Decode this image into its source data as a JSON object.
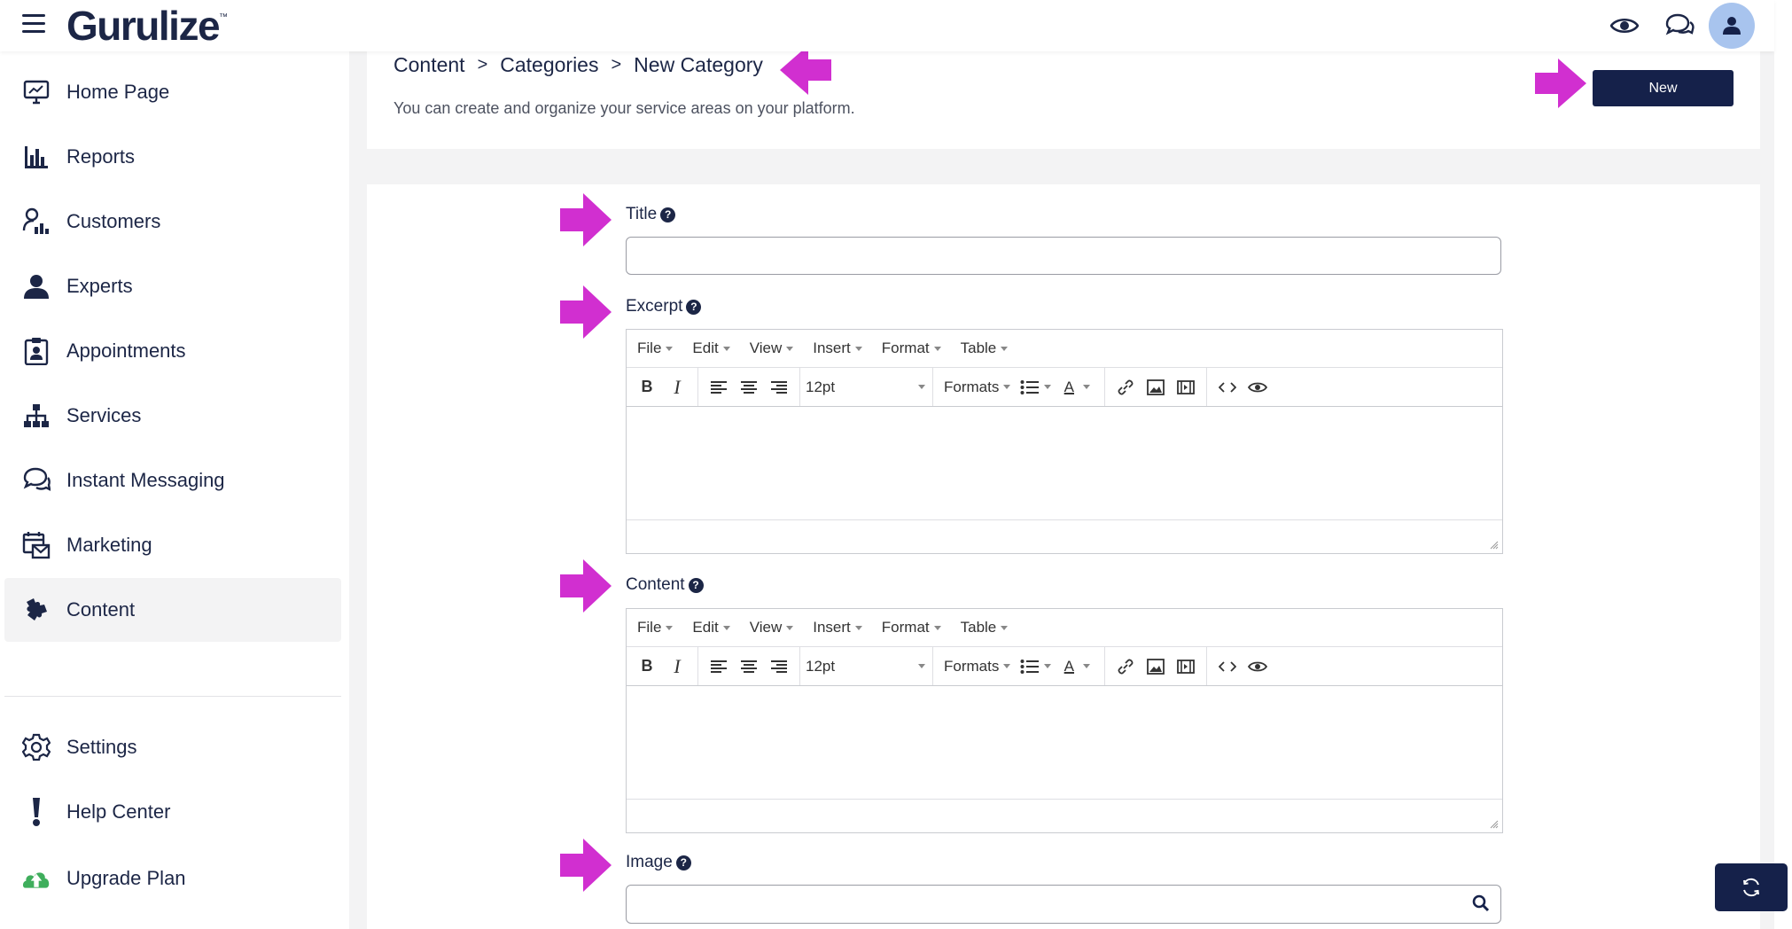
{
  "app": {
    "logo": "Gurulize",
    "trademark": "™"
  },
  "sidebar": {
    "items": [
      {
        "label": "Home Page",
        "icon": "monitor-icon"
      },
      {
        "label": "Reports",
        "icon": "bar-chart-icon"
      },
      {
        "label": "Customers",
        "icon": "customers-icon"
      },
      {
        "label": "Experts",
        "icon": "user-icon"
      },
      {
        "label": "Appointments",
        "icon": "clipboard-user-icon"
      },
      {
        "label": "Services",
        "icon": "sitemap-icon"
      },
      {
        "label": "Instant Messaging",
        "icon": "chat-icon"
      },
      {
        "label": "Marketing",
        "icon": "mail-calendar-icon"
      },
      {
        "label": "Content",
        "icon": "puzzle-icon",
        "active": true
      }
    ],
    "bottom_items": [
      {
        "label": "Settings",
        "icon": "gear-icon"
      },
      {
        "label": "Help Center",
        "icon": "exclamation-icon"
      },
      {
        "label": "Upgrade Plan",
        "icon": "upgrade-icon"
      }
    ]
  },
  "header": {
    "breadcrumb": [
      "Content",
      "Categories",
      "New Category"
    ],
    "breadcrumb_separator": ">",
    "subtitle": "You can create and organize your service areas on your platform.",
    "new_button": "New"
  },
  "form": {
    "title_label": "Title",
    "excerpt_label": "Excerpt",
    "content_label": "Content",
    "image_label": "Image",
    "help_glyph": "?",
    "title_value": "",
    "image_value": ""
  },
  "editor": {
    "menu": [
      "File",
      "Edit",
      "View",
      "Insert",
      "Format",
      "Table"
    ],
    "font_size": "12pt",
    "formats_label": "Formats",
    "bold": "B",
    "italic": "I",
    "font_color": "A"
  },
  "colors": {
    "primary": "#15214a",
    "text": "#1c2646",
    "accent_arrow": "#d12fd0",
    "avatar_bg": "#a8c4ee",
    "upgrade_green": "#3fae5c"
  }
}
